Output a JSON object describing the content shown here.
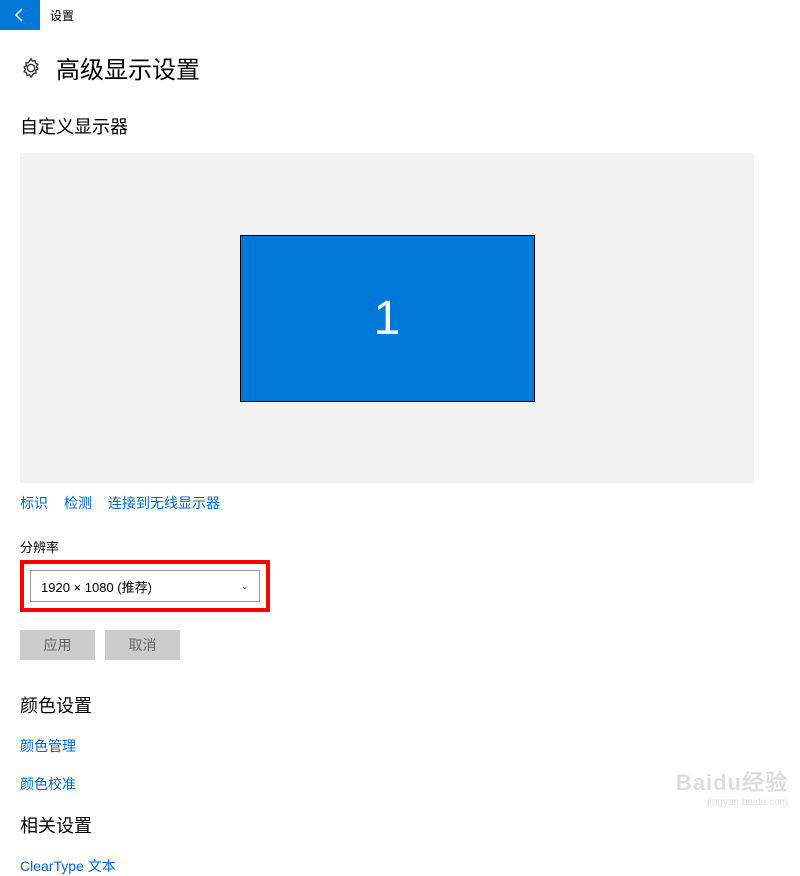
{
  "titlebar": {
    "app_title": "设置"
  },
  "header": {
    "page_title": "高级显示设置"
  },
  "customize": {
    "section_title": "自定义显示器",
    "monitor_number": "1",
    "links": {
      "identify": "标识",
      "detect": "检测",
      "connect_wireless": "连接到无线显示器"
    }
  },
  "resolution": {
    "label": "分辨率",
    "selected": "1920 × 1080 (推荐)"
  },
  "buttons": {
    "apply": "应用",
    "cancel": "取消"
  },
  "color": {
    "section_title": "颜色设置",
    "color_management": "颜色管理",
    "color_calibration": "颜色校准"
  },
  "related": {
    "section_title": "相关设置",
    "cleartype": "ClearType 文本"
  },
  "watermark": {
    "brand_a": "Bai",
    "brand_b": "du",
    "brand_c": "经验",
    "url": "jingyan.baidu.com"
  }
}
